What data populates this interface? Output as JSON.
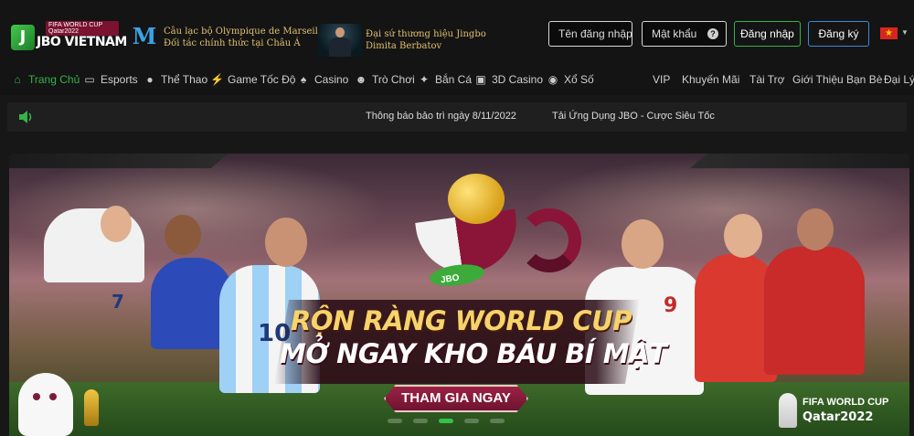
{
  "header": {
    "logo": {
      "cup_label": "FIFA WORLD CUP Qatar2022",
      "brand": "JBO VIETNAM"
    },
    "partner_club": {
      "line1": "Câu lạc bộ Olympique de Marseille",
      "line2": "Đối tác chính thức tại Châu Á"
    },
    "ambassador": {
      "line1": "Đại sứ thương hiệu Jingbo",
      "line2": "Dimita Berbatov"
    },
    "username_placeholder": "Tên đăng nhập",
    "password_placeholder": "Mật khẩu",
    "help_icon_glyph": "?",
    "login_label": "Đăng nhập",
    "register_label": "Đăng ký",
    "language_flag": "vietnam-flag-icon"
  },
  "nav": {
    "items": [
      {
        "label": "Trang Chủ",
        "icon": "home-icon",
        "glyph": "⌂",
        "active": true
      },
      {
        "label": "Esports",
        "icon": "gamepad-icon",
        "glyph": "🎮"
      },
      {
        "label": "Thể Thao",
        "icon": "soccer-ball-icon",
        "glyph": "⚽"
      },
      {
        "label": "Game Tốc Độ",
        "icon": "speed-icon",
        "glyph": "⚡"
      },
      {
        "label": "Casino",
        "icon": "cards-icon",
        "glyph": "♠"
      },
      {
        "label": "Trò Chơi",
        "icon": "game-controller-icon",
        "glyph": "☻"
      },
      {
        "label": "Bắn Cá",
        "icon": "fish-icon",
        "glyph": "✦"
      },
      {
        "label": "3D Casino",
        "icon": "cube-icon",
        "glyph": "▣"
      },
      {
        "label": "Xổ Số",
        "icon": "lottery-icon",
        "glyph": "◉"
      }
    ],
    "right_items": [
      {
        "label": "VIP"
      },
      {
        "label": "Khuyến Mãi"
      },
      {
        "label": "Tài Trợ"
      },
      {
        "label": "Giới Thiệu Bạn Bè"
      },
      {
        "label": "Đại Lý"
      }
    ]
  },
  "notice": {
    "speaker_icon": "speaker-icon",
    "messages": [
      "Thông báo bảo trì ngày 8/11/2022",
      "Tải Ứng Dụng JBO - Cược Siêu Tốc"
    ]
  },
  "banner": {
    "headline_1": "RỘN RÀNG WORLD CUP",
    "headline_2": "MỞ NGAY KHO BÁU BÍ MẬT",
    "cta_label": "THAM GIA NGAY",
    "trophy_logo": "JBO",
    "badge_line1": "FIFA WORLD CUP",
    "badge_line2": "Qatar2022",
    "jersey_numbers": [
      "7",
      "10",
      "9"
    ],
    "slides_count": 5,
    "active_slide": 2
  },
  "colors": {
    "accent_green": "#35b24a",
    "register_blue": "#3d8ad6",
    "banner_maroon": "#8a1538",
    "headline_gold": "#f6d36b"
  }
}
